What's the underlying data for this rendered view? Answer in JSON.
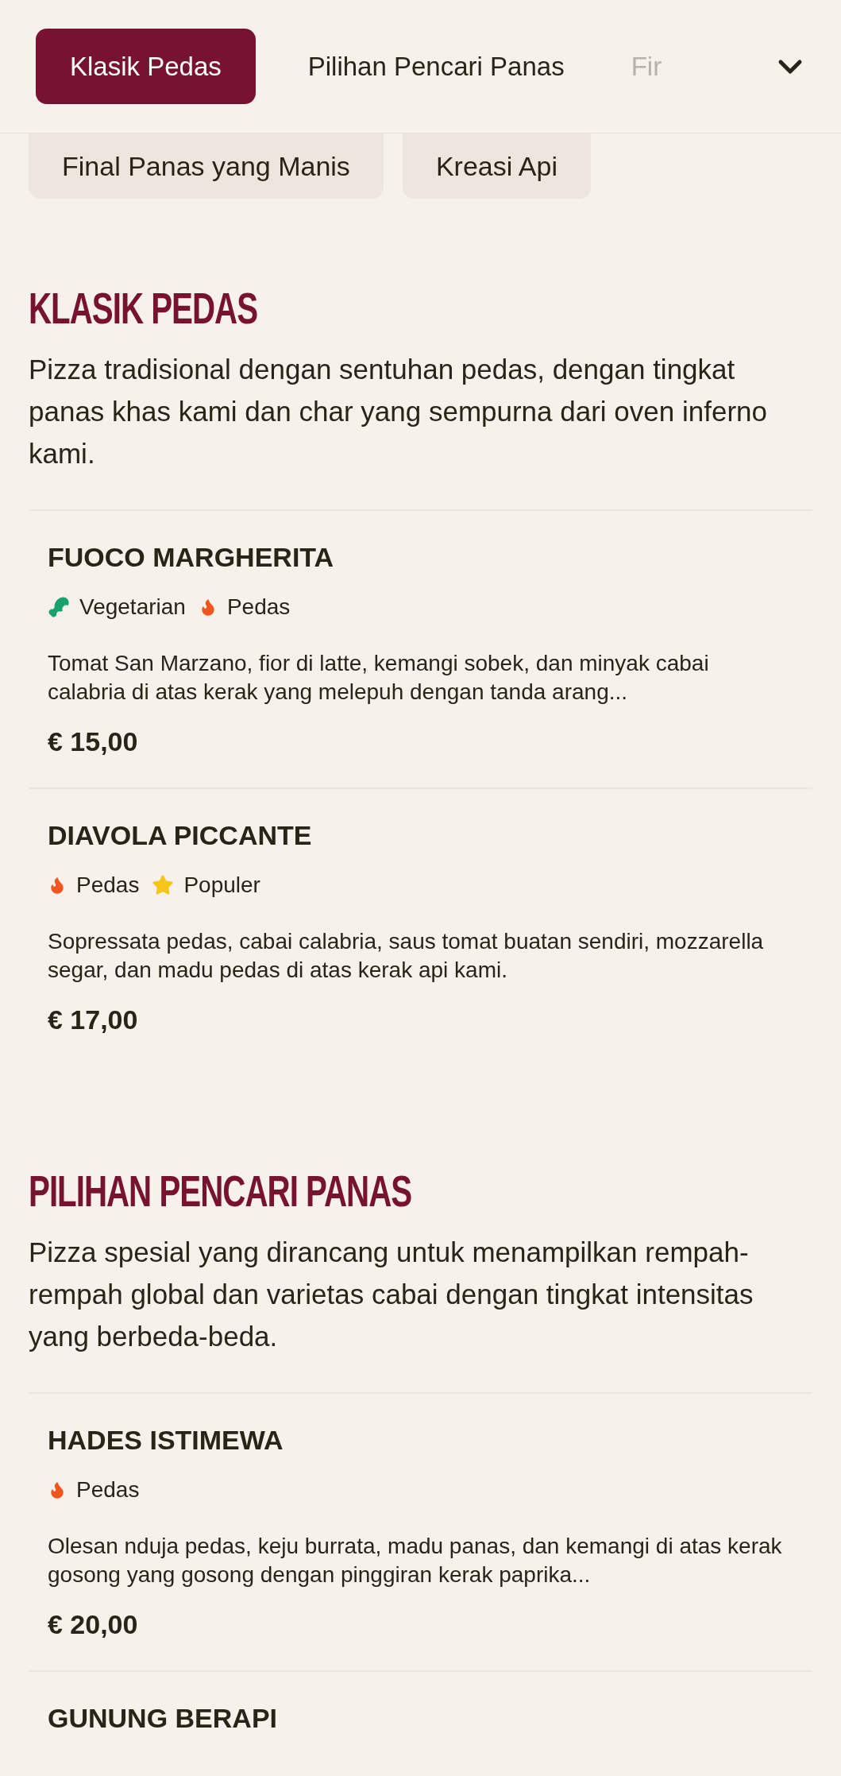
{
  "tabs": [
    {
      "label": "Klasik Pedas",
      "selected": true
    },
    {
      "label": "Pilihan Pencari Panas",
      "selected": false
    },
    {
      "label": "Fir",
      "selected": false
    }
  ],
  "subtabs": [
    {
      "label": "Final Panas yang Manis",
      "selected": false
    },
    {
      "label": "Kreasi Api",
      "selected": false
    }
  ],
  "sections": [
    {
      "title": "KLASIK PEDAS",
      "description": "Pizza tradisional dengan sentuhan pedas, dengan tingkat panas khas kami dan char yang sempurna dari oven inferno kami.",
      "items": [
        {
          "name": "FUOCO MARGHERITA",
          "tags": [
            {
              "kind": "vegetarian",
              "label": "Vegetarian"
            },
            {
              "kind": "spicy",
              "label": "Pedas"
            }
          ],
          "description": "Tomat San Marzano, fior di latte, kemangi sobek, dan minyak cabai calabria di atas kerak yang melepuh dengan tanda arang...",
          "price": "€ 15,00"
        },
        {
          "name": "DIAVOLA PICCANTE",
          "tags": [
            {
              "kind": "spicy",
              "label": "Pedas"
            },
            {
              "kind": "popular",
              "label": "Populer"
            }
          ],
          "description": "Sopressata pedas, cabai calabria, saus tomat buatan sendiri, mozzarella segar, dan madu pedas di atas kerak api kami.",
          "price": "€ 17,00"
        }
      ]
    },
    {
      "title": "PILIHAN PENCARI PANAS",
      "description": "Pizza spesial yang dirancang untuk menampilkan rempah-rempah global dan varietas cabai dengan tingkat intensitas yang berbeda-beda.",
      "items": [
        {
          "name": "HADES ISTIMEWA",
          "tags": [
            {
              "kind": "spicy",
              "label": "Pedas"
            }
          ],
          "description": "Olesan nduja pedas, keju burrata, madu panas, dan kemangi di atas kerak gosong yang gosong dengan pinggiran kerak paprika...",
          "price": "€ 20,00"
        },
        {
          "name": "GUNUNG BERAPI"
        }
      ]
    }
  ]
}
